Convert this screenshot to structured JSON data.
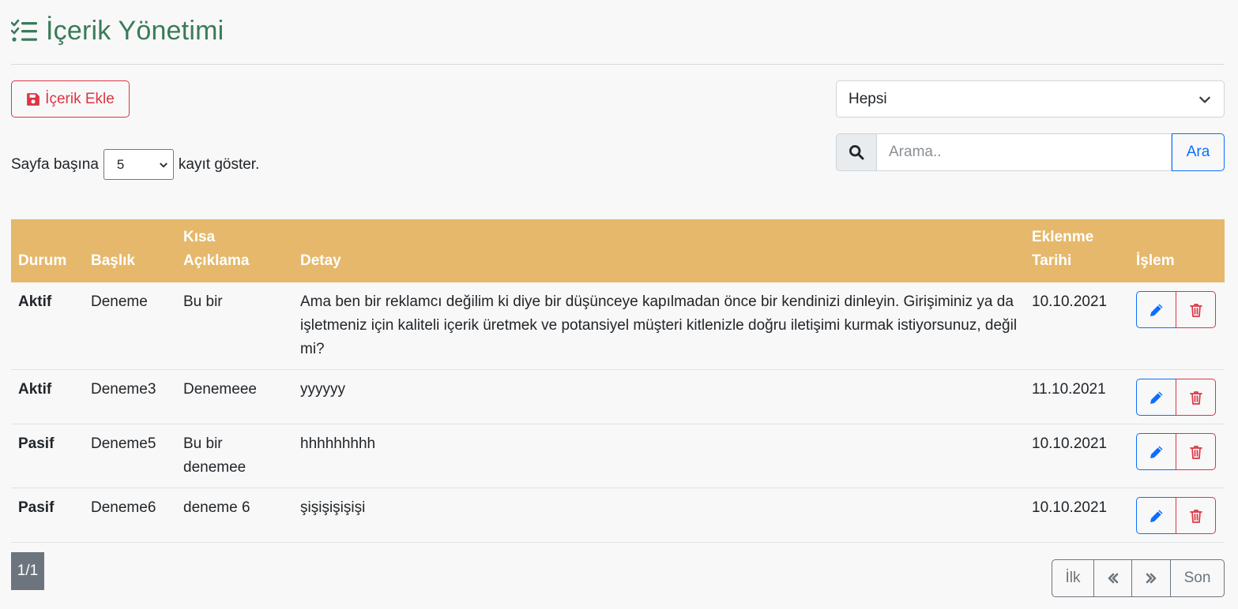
{
  "header": {
    "title": "İçerik Yönetimi",
    "icon": "list-check-icon",
    "title_color": "#3a7a5a"
  },
  "toolbar": {
    "add_label": "İçerik Ekle",
    "add_icon": "save-icon",
    "filter_value": "Hepsi",
    "per_page_prefix": "Sayfa başına",
    "per_page_value": "5",
    "per_page_suffix": "kayıt göster.",
    "search_placeholder": "Arama..",
    "search_button": "Ara"
  },
  "table": {
    "header_color": "#e5b86b",
    "columns": {
      "durum": "Durum",
      "baslik": "Başlık",
      "kisa_1": "Kısa",
      "kisa_2": "Açıklama",
      "detay": "Detay",
      "tarih_1": "Eklenme",
      "tarih_2": "Tarihi",
      "islem": "İşlem"
    },
    "rows": [
      {
        "durum": "Aktif",
        "baslik": "Deneme",
        "kisa": "Bu bir",
        "detay": "Ama ben bir reklamcı değilim ki diye bir düşünceye kapılmadan önce bir kendinizi dinleyin. Girişiminiz ya da işletmeniz için kaliteli içerik üretmek ve potansiyel müşteri kitlenizle doğru iletişimi kurmak istiyorsunuz, değil mi?",
        "tarih": "10.10.2021"
      },
      {
        "durum": "Aktif",
        "baslik": "Deneme3",
        "kisa": "Denemeee",
        "detay": "yyyyyy",
        "tarih": "11.10.2021"
      },
      {
        "durum": "Pasif",
        "baslik": "Deneme5",
        "kisa": "Bu bir denemee",
        "detay": "hhhhhhhhh",
        "tarih": "10.10.2021"
      },
      {
        "durum": "Pasif",
        "baslik": "Deneme6",
        "kisa": "deneme 6",
        "detay": "şişişişişişi",
        "tarih": "10.10.2021"
      }
    ]
  },
  "pagination": {
    "indicator": "1/1",
    "first": "İlk",
    "prev_icon": "chevrons-left-icon",
    "next_icon": "chevrons-right-icon",
    "last": "Son"
  }
}
